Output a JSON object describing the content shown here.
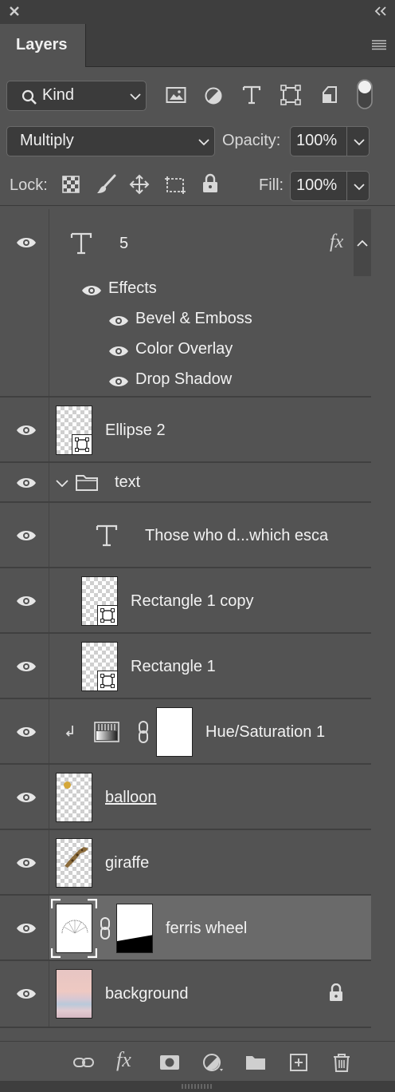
{
  "panel": {
    "tab_label": "Layers"
  },
  "filter": {
    "kind_label": "Kind"
  },
  "blend": {
    "mode": "Multiply",
    "opacity_label": "Opacity:",
    "opacity_value": "100%"
  },
  "lock": {
    "label": "Lock:",
    "fill_label": "Fill:",
    "fill_value": "100%"
  },
  "layers": {
    "text5": {
      "name": "5",
      "effects_label": "Effects",
      "effects": [
        "Bevel & Emboss",
        "Color Overlay",
        "Drop Shadow"
      ]
    },
    "ellipse2": "Ellipse 2",
    "group_text": "text",
    "text_long": "Those who d...which esca",
    "rect1copy": "Rectangle 1 copy",
    "rect1": "Rectangle 1",
    "huesat": "Hue/Saturation 1",
    "balloon": "balloon",
    "giraffe": "giraffe",
    "ferris": "ferris wheel",
    "background": "background"
  },
  "colors": {
    "panel_bg": "#535353",
    "selected_row": "#6a6a6a",
    "balloon_dot": "#d4a73a"
  }
}
